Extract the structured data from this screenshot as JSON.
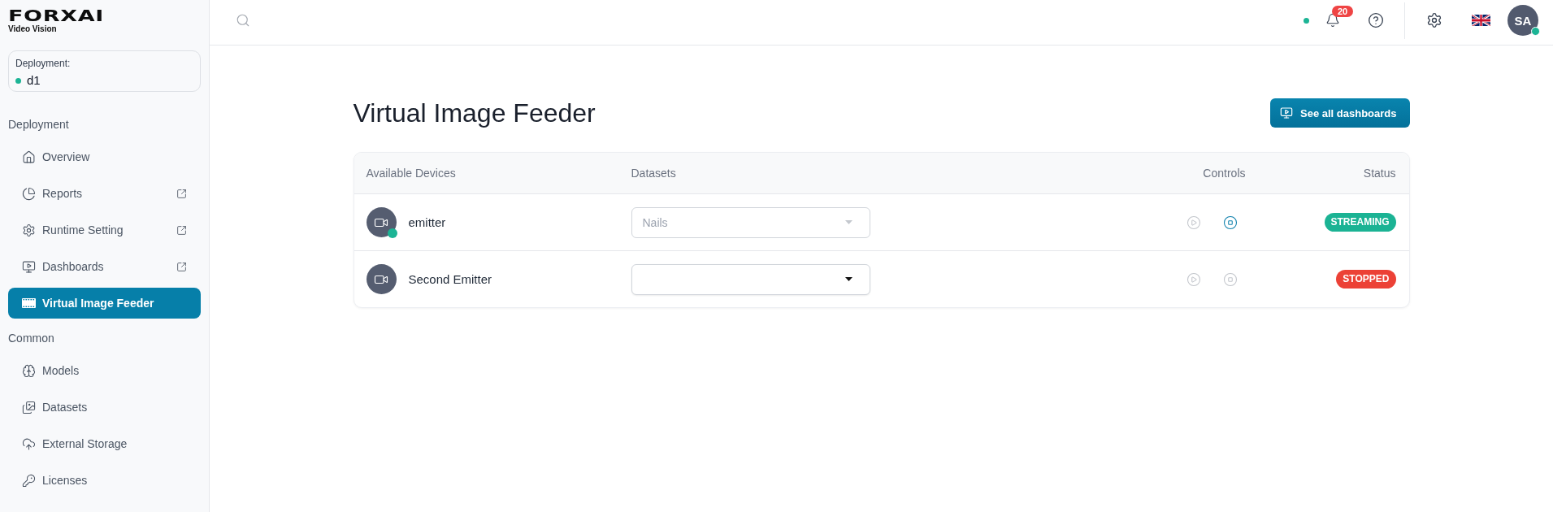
{
  "logo": {
    "wordmark": "FORXAI",
    "tagline": "Video Vision"
  },
  "deployment_card": {
    "label": "Deployment:",
    "name": "d1",
    "online": true
  },
  "sidebar": {
    "sections": [
      {
        "title": "Deployment",
        "items": [
          {
            "label": "Overview",
            "external": false,
            "selected": false
          },
          {
            "label": "Reports",
            "external": true,
            "selected": false
          },
          {
            "label": "Runtime Setting",
            "external": true,
            "selected": false
          },
          {
            "label": "Dashboards",
            "external": true,
            "selected": false
          },
          {
            "label": "Virtual Image Feeder",
            "external": false,
            "selected": true
          }
        ]
      },
      {
        "title": "Common",
        "items": [
          {
            "label": "Models",
            "external": false,
            "selected": false
          },
          {
            "label": "Datasets",
            "external": false,
            "selected": false
          },
          {
            "label": "External Storage",
            "external": false,
            "selected": false
          },
          {
            "label": "Licenses",
            "external": false,
            "selected": false
          }
        ]
      }
    ]
  },
  "top_bar": {
    "connection_online": true,
    "notifications": {
      "count": "20"
    },
    "user": {
      "initials": "SA",
      "online": true
    }
  },
  "page": {
    "title": "Virtual Image Feeder",
    "action_button": {
      "label": "See all dashboards"
    }
  },
  "table": {
    "columns": [
      "Available Devices",
      "Datasets",
      "Controls",
      "Status"
    ],
    "rows": [
      {
        "device": "emitter",
        "online": true,
        "dataset": {
          "value": "Nails",
          "disabled": true
        },
        "play": {
          "disabled": true
        },
        "stop": {
          "disabled": false
        },
        "status": {
          "label": "STREAMING",
          "color": "#1bb394"
        }
      },
      {
        "device": "Second Emitter",
        "online": false,
        "dataset": {
          "disabled": false
        },
        "play": {
          "disabled": true
        },
        "stop": {
          "disabled": true
        },
        "status": {
          "label": "STOPPED",
          "color": "#ec4136"
        }
      }
    ]
  }
}
